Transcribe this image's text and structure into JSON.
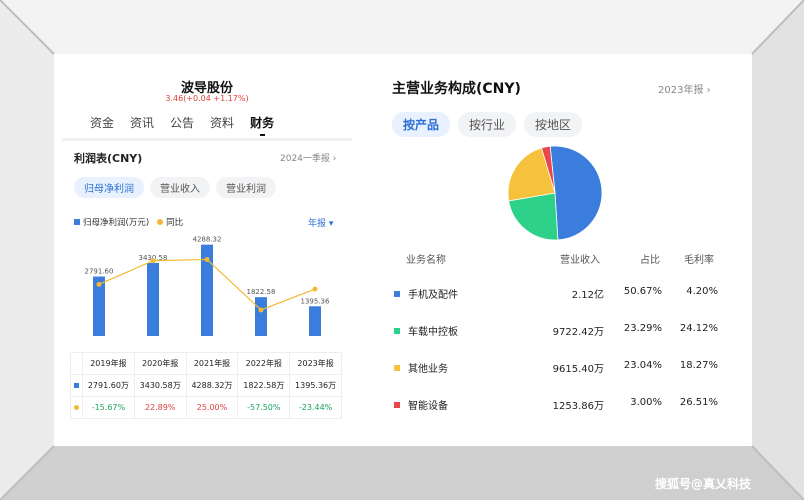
{
  "stock": {
    "name": "波导股份",
    "price_line": "3.46(+0.04 +1.17%)"
  },
  "tabs": [
    "资金",
    "资讯",
    "公告",
    "资料",
    "财务"
  ],
  "active_tab": "财务",
  "income": {
    "title": "利润表(CNY)",
    "period": "2024一季报 ›",
    "chips": [
      "归母净利润",
      "营业收入",
      "营业利润"
    ],
    "legend_bar": "归母净利润(万元)",
    "legend_line": "同比",
    "period_select": "年报 ▾",
    "years": [
      "2019年报",
      "2020年报",
      "2021年报",
      "2022年报",
      "2023年报"
    ],
    "values_fmt": [
      "2791.60万",
      "3430.58万",
      "4288.32万",
      "1822.58万",
      "1395.36万"
    ],
    "yoy_fmt": [
      "-15.67%",
      "22.89%",
      "25.00%",
      "-57.50%",
      "-23.44%"
    ]
  },
  "chart_data": {
    "type": "bar",
    "categories": [
      "2019年报",
      "2020年报",
      "2021年报",
      "2022年报",
      "2023年报"
    ],
    "series": [
      {
        "name": "归母净利润(万元)",
        "type": "bar",
        "color": "#3b7ddd",
        "values": [
          2791.6,
          3430.58,
          4288.32,
          1822.58,
          1395.36
        ],
        "labels": [
          "2791.60",
          "3430.58",
          "4288.32",
          "1822.58",
          "1395.36"
        ]
      },
      {
        "name": "同比",
        "type": "line",
        "color": "#f2b935",
        "values": [
          -15.67,
          22.89,
          25.0,
          -57.5,
          -23.44
        ]
      }
    ],
    "ylim": [
      0,
      4600
    ],
    "y2lim": [
      -100,
      60
    ]
  },
  "business": {
    "title": "主营业务构成(CNY)",
    "period": "2023年报 ›",
    "tabs": [
      "按产品",
      "按行业",
      "按地区"
    ],
    "headers": [
      "业务名称",
      "营业收入",
      "占比",
      "毛利率"
    ],
    "rows": [
      {
        "name": "手机及配件",
        "revenue": "2.12亿",
        "share": "50.67%",
        "margin": "4.20%",
        "color": "#3b7ddd",
        "share_value": 50.67
      },
      {
        "name": "车载中控板",
        "revenue": "9722.42万",
        "share": "23.29%",
        "margin": "24.12%",
        "color": "#2ed18a",
        "share_value": 23.29
      },
      {
        "name": "其他业务",
        "revenue": "9615.40万",
        "share": "23.04%",
        "margin": "18.27%",
        "color": "#f7c23b",
        "share_value": 23.04
      },
      {
        "name": "智能设备",
        "revenue": "1253.86万",
        "share": "3.00%",
        "margin": "26.51%",
        "color": "#e9484a",
        "share_value": 3.0
      }
    ]
  },
  "watermark": "搜狐号@真乂科技"
}
